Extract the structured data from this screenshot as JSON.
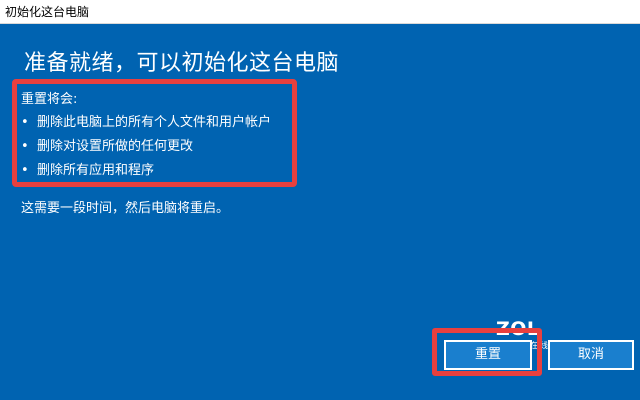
{
  "window": {
    "title": "初始化这台电脑"
  },
  "main": {
    "heading": "准备就绪，可以初始化这台电脑",
    "intro": "重置将会:",
    "bullet_glyph": "•",
    "bullets": [
      "删除此电脑上的所有个人文件和用户帐户",
      "删除对设置所做的任何更改",
      "删除所有应用和程序"
    ],
    "note": "这需要一段时间，然后电脑将重启。"
  },
  "buttons": {
    "reset_label": "重置",
    "cancel_label": "取消"
  },
  "watermark": {
    "logo": "ZOL",
    "subtitle": "中关村在线"
  },
  "colors": {
    "background": "#0063b1",
    "highlight": "#e8403f",
    "button": "#1a7fce"
  }
}
